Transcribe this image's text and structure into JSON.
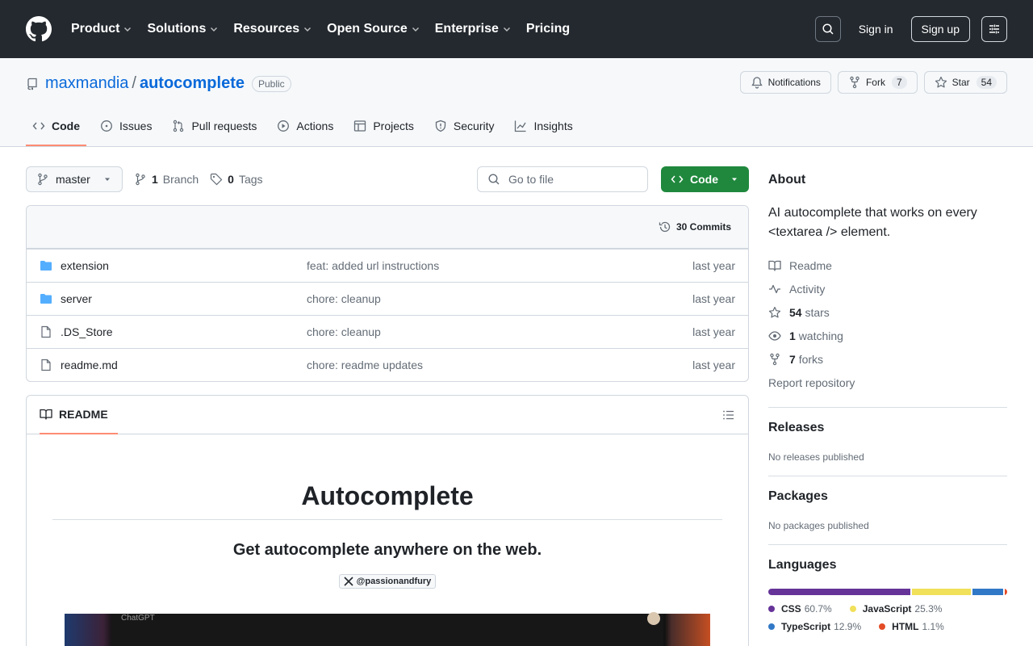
{
  "topnav": {
    "items": [
      {
        "label": "Product"
      },
      {
        "label": "Solutions"
      },
      {
        "label": "Resources"
      },
      {
        "label": "Open Source"
      },
      {
        "label": "Enterprise"
      },
      {
        "label": "Pricing"
      }
    ],
    "sign_in": "Sign in",
    "sign_up": "Sign up"
  },
  "repo": {
    "owner": "maxmandia",
    "slash": "/",
    "name": "autocomplete",
    "visibility": "Public",
    "notifications_label": "Notifications",
    "fork_label": "Fork",
    "fork_count": "7",
    "star_label": "Star",
    "star_count": "54"
  },
  "reponav": {
    "tabs": [
      {
        "label": "Code"
      },
      {
        "label": "Issues"
      },
      {
        "label": "Pull requests"
      },
      {
        "label": "Actions"
      },
      {
        "label": "Projects"
      },
      {
        "label": "Security"
      },
      {
        "label": "Insights"
      }
    ]
  },
  "filebar": {
    "branch": "master",
    "branch_count": "1",
    "branch_word": "Branch",
    "tag_count": "0",
    "tag_word": "Tags",
    "goto_placeholder": "Go to file",
    "code_button": "Code"
  },
  "files": {
    "commits_label": "30 Commits",
    "rows": [
      {
        "name": "extension",
        "type": "folder",
        "message": "feat: added url instructions",
        "time": "last year"
      },
      {
        "name": "server",
        "type": "folder",
        "message": "chore: cleanup",
        "time": "last year"
      },
      {
        "name": ".DS_Store",
        "type": "file",
        "message": "chore: cleanup",
        "time": "last year"
      },
      {
        "name": "readme.md",
        "type": "file",
        "message": "chore: readme updates",
        "time": "last year"
      }
    ]
  },
  "readme": {
    "tab_label": "README",
    "title": "Autocomplete",
    "subtitle": "Get autocomplete anywhere on the web.",
    "badge": "@passionandfury",
    "image_caption": "ChatGPT"
  },
  "sidebar": {
    "about_heading": "About",
    "description": "AI autocomplete that works on every <textarea /> element.",
    "links": {
      "readme": "Readme",
      "activity": "Activity",
      "stars_count": "54",
      "stars_word": "stars",
      "watching_count": "1",
      "watching_word": "watching",
      "forks_count": "7",
      "forks_word": "forks",
      "report": "Report repository"
    },
    "releases_heading": "Releases",
    "releases_text": "No releases published",
    "packages_heading": "Packages",
    "packages_text": "No packages published",
    "languages_heading": "Languages",
    "languages": [
      {
        "name": "CSS",
        "percent": "60.7%",
        "share": 60.7,
        "color": "#663399"
      },
      {
        "name": "JavaScript",
        "percent": "25.3%",
        "share": 25.3,
        "color": "#f1e05a"
      },
      {
        "name": "TypeScript",
        "percent": "12.9%",
        "share": 12.9,
        "color": "#3178c6"
      },
      {
        "name": "HTML",
        "percent": "1.1%",
        "share": 1.1,
        "color": "#e34c26"
      }
    ]
  },
  "colors": {
    "header_bg": "#24292f",
    "link": "#0969da",
    "green": "#1f883d",
    "active_tab_underline": "#fd8c73",
    "folder": "#54aeff"
  }
}
